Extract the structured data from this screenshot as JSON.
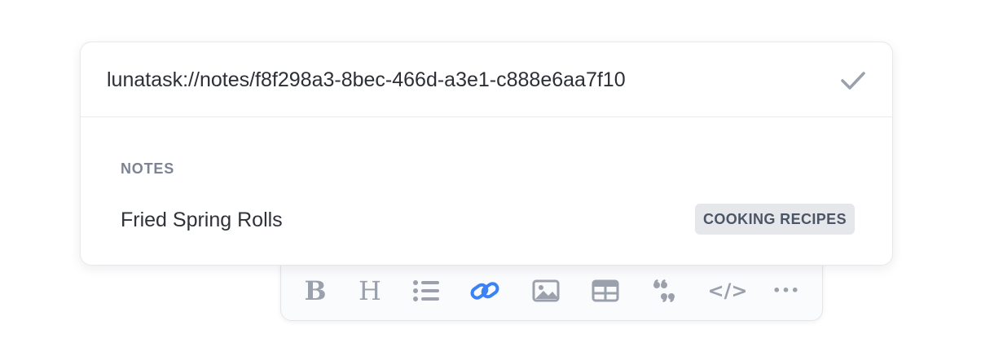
{
  "link_popover": {
    "url_value": "lunatask://notes/f8f298a3-8bec-466d-a3e1-c888e6aa7f10",
    "confirm_icon": "check-icon",
    "section_label": "NOTES",
    "results": [
      {
        "title": "Fried Spring Rolls",
        "badge": "COOKING RECIPES"
      }
    ]
  },
  "toolbar": {
    "buttons": [
      {
        "name": "bold",
        "icon": "bold-icon",
        "glyph": "B"
      },
      {
        "name": "heading",
        "icon": "heading-icon",
        "glyph": "H"
      },
      {
        "name": "bullet-list",
        "icon": "bullet-list-icon"
      },
      {
        "name": "link",
        "icon": "link-icon",
        "active": true
      },
      {
        "name": "image",
        "icon": "image-icon"
      },
      {
        "name": "table",
        "icon": "table-icon"
      },
      {
        "name": "quote",
        "icon": "quote-icon"
      },
      {
        "name": "code",
        "icon": "code-icon",
        "glyph": "</>"
      },
      {
        "name": "more",
        "icon": "more-icon",
        "glyph": "•••"
      }
    ]
  },
  "colors": {
    "accent": "#3b82f6",
    "icon_muted": "#9aa1ad",
    "badge_bg": "#e5e7eb",
    "text": "#2f3238"
  }
}
